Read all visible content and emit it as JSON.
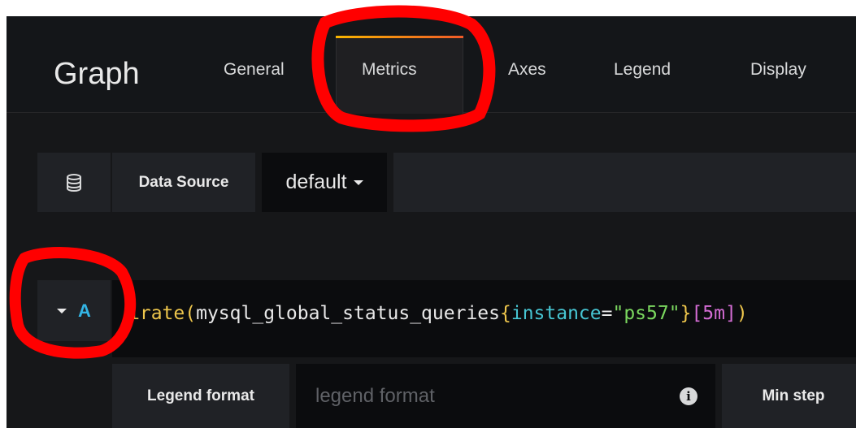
{
  "panel": {
    "title": "Graph",
    "tabs": [
      {
        "label": "General"
      },
      {
        "label": "Metrics"
      },
      {
        "label": "Axes"
      },
      {
        "label": "Legend"
      },
      {
        "label": "Display"
      }
    ],
    "active_tab": "Metrics"
  },
  "datasource": {
    "label": "Data Source",
    "selected": "default",
    "icon": "database-icon"
  },
  "query": {
    "ref_id": "A",
    "expr_parts": [
      "irate",
      "(",
      "mysql_global_status_queries",
      "{",
      "instance",
      "=",
      "\"ps57\"",
      "}",
      "[5m]",
      ")"
    ]
  },
  "options": {
    "legend_label": "Legend format",
    "legend_placeholder": "legend format",
    "legend_value": "",
    "min_step_label": "Min step"
  },
  "colors": {
    "active_tab_gradient_start": "#f7b500",
    "active_tab_gradient_end": "#f05a28",
    "annotation_red": "#ff0000",
    "ref_id_blue": "#33b5e5"
  }
}
